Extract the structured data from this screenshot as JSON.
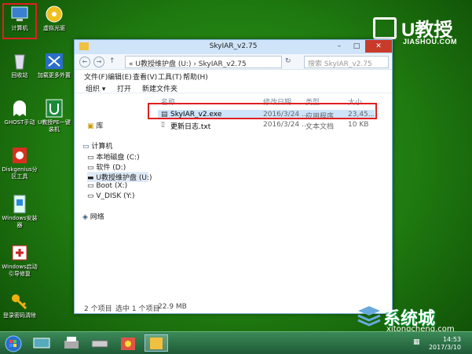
{
  "desktop": {
    "icons": [
      {
        "label": "计算机"
      },
      {
        "label": "虚拟光驱"
      },
      {
        "label": "回收站"
      },
      {
        "label": "加载更多外置"
      },
      {
        "label": "GHOST手动"
      },
      {
        "label": "U教授PE一键装机"
      },
      {
        "label": "Diskgenius分区工具"
      },
      {
        "label": "Windows安装器"
      },
      {
        "label": "Windows启动引导修复"
      },
      {
        "label": "登录密码清除"
      }
    ]
  },
  "logo": {
    "main": "U教授",
    "url": "JIASHOU.COM"
  },
  "window": {
    "title": "SkyIAR_v2.75",
    "address": "« U教授维护盘 (U:) › SkyIAR_v2.75",
    "search_placeholder": "搜索 SkyIAR_v2.75",
    "menu": [
      "文件(F)",
      "编辑(E)",
      "查看(V)",
      "工具(T)",
      "帮助(H)"
    ],
    "toolbar": [
      "组织 ▾",
      "打开",
      "新建文件夹"
    ],
    "nav": {
      "library": "库",
      "computer": "计算机",
      "drives": [
        "本地磁盘 (C:)",
        "软件 (D:)",
        "U教授维护盘 (U:)",
        "Boot (X:)",
        "V_DISK (Y:)"
      ],
      "network": "网络"
    },
    "columns": {
      "name": "名称",
      "date": "修改日期",
      "type": "类型",
      "size": "大小"
    },
    "files": [
      {
        "name": "SkyIAR_v2.exe",
        "date": "2016/3/24 ...",
        "type": "应用程序",
        "size": "23,45..."
      },
      {
        "name": "更新日志.txt",
        "date": "2016/3/24 ...",
        "type": "文本文档",
        "size": "10 KB"
      }
    ],
    "status": {
      "count": "2 个项目",
      "selected": "选中 1 个项目",
      "size": "22.9 MB"
    }
  },
  "taskbar": {
    "time": "14:53",
    "date": "2017/3/10"
  },
  "watermark": {
    "main": "系统城",
    "url": "xitongcheng.com"
  },
  "colors": {
    "highlight": "#e02020",
    "desktop": "#2f9e1c"
  }
}
